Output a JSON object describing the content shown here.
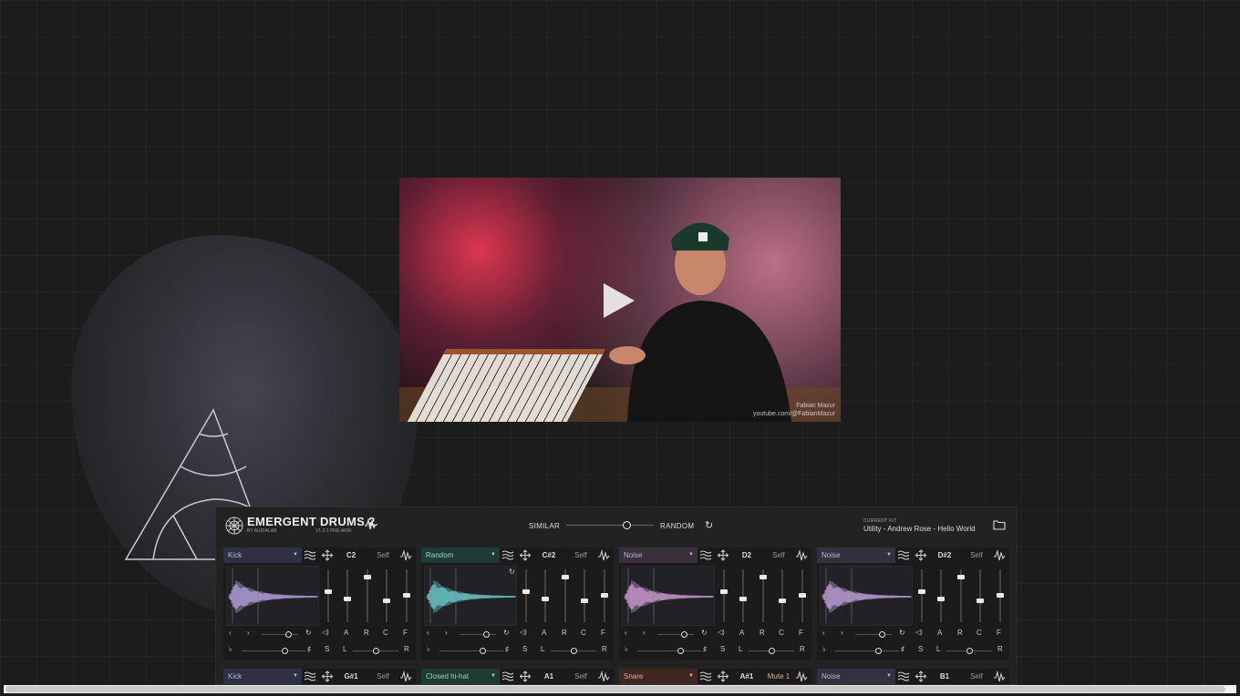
{
  "video": {
    "credit_line1": "Fabian Mazur",
    "credit_line2": "youtube.com/@FabianMazur"
  },
  "plugin": {
    "title": "EMERGENT DRUMS 2",
    "by": "BY AUDIALAB",
    "version": "V1.0.1 PRE-ARM",
    "similar_label": "SIMILAR",
    "random_label": "RANDOM",
    "similarity_value": 0.7,
    "current_kit_label": "CURRENT KIT",
    "current_kit_name": "Utility - Andrew Rose - Hello World",
    "fader_labels": [
      "A",
      "R",
      "C",
      "F"
    ],
    "bottom_labels": {
      "s": "S",
      "l": "L",
      "r": "R"
    },
    "pads": [
      {
        "sound": "Kick",
        "note": "C2",
        "mode": "Self",
        "color": "#2f2f46",
        "wave": "#b9a6e6"
      },
      {
        "sound": "Random",
        "note": "C#2",
        "mode": "Self",
        "color": "#1f3a37",
        "wave": "#6fd0d4"
      },
      {
        "sound": "Noise",
        "note": "D2",
        "mode": "Self",
        "color": "#3b2f3c",
        "wave": "#d4a0dc"
      },
      {
        "sound": "Noise",
        "note": "D#2",
        "mode": "Self",
        "color": "#33303f",
        "wave": "#c6a5e0"
      }
    ],
    "row2": [
      {
        "sound": "Kick",
        "note": "G#1",
        "mode": "Self",
        "color": "#2f2f46"
      },
      {
        "sound": "Closed hi-hat",
        "note": "A1",
        "mode": "Self",
        "color": "#1f3a2e"
      },
      {
        "sound": "Snare",
        "note": "A#1",
        "mode": "Mute 1",
        "color": "#3f2722"
      },
      {
        "sound": "Noise",
        "note": "B1",
        "mode": "Self",
        "color": "#33303f"
      }
    ]
  }
}
